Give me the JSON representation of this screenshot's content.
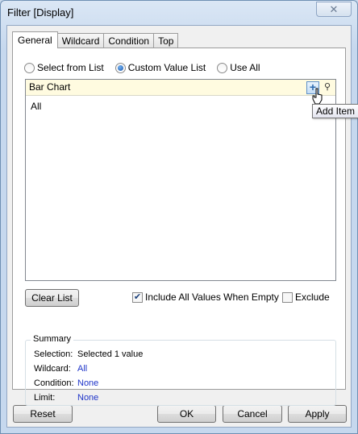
{
  "window": {
    "title": "Filter [Display]"
  },
  "tabs": [
    {
      "label": "General"
    },
    {
      "label": "Wildcard"
    },
    {
      "label": "Condition"
    },
    {
      "label": "Top"
    }
  ],
  "mode_options": [
    {
      "label": "Select from List",
      "selected": false
    },
    {
      "label": "Custom Value List",
      "selected": true
    },
    {
      "label": "Use All",
      "selected": false
    }
  ],
  "value_list": {
    "input_value": "Bar Chart",
    "items": [
      "All"
    ],
    "add_tooltip": "Add Item",
    "add_glyph": "+",
    "search_glyph": "⚲"
  },
  "controls": {
    "clear_list": "Clear List",
    "include_all_label": "Include All Values When Empty",
    "include_all_checked": true,
    "exclude_label": "Exclude",
    "exclude_checked": false
  },
  "summary": {
    "heading": "Summary",
    "rows": [
      {
        "label": "Selection:",
        "value": "Selected 1 value"
      },
      {
        "label": "Wildcard:",
        "value": "All"
      },
      {
        "label": "Condition:",
        "value": "None"
      },
      {
        "label": "Limit:",
        "value": "None"
      }
    ]
  },
  "footer": {
    "reset": "Reset",
    "ok": "OK",
    "cancel": "Cancel",
    "apply": "Apply"
  },
  "colors": {
    "input_highlight": "#fffbe0",
    "link": "#1f35c9"
  }
}
